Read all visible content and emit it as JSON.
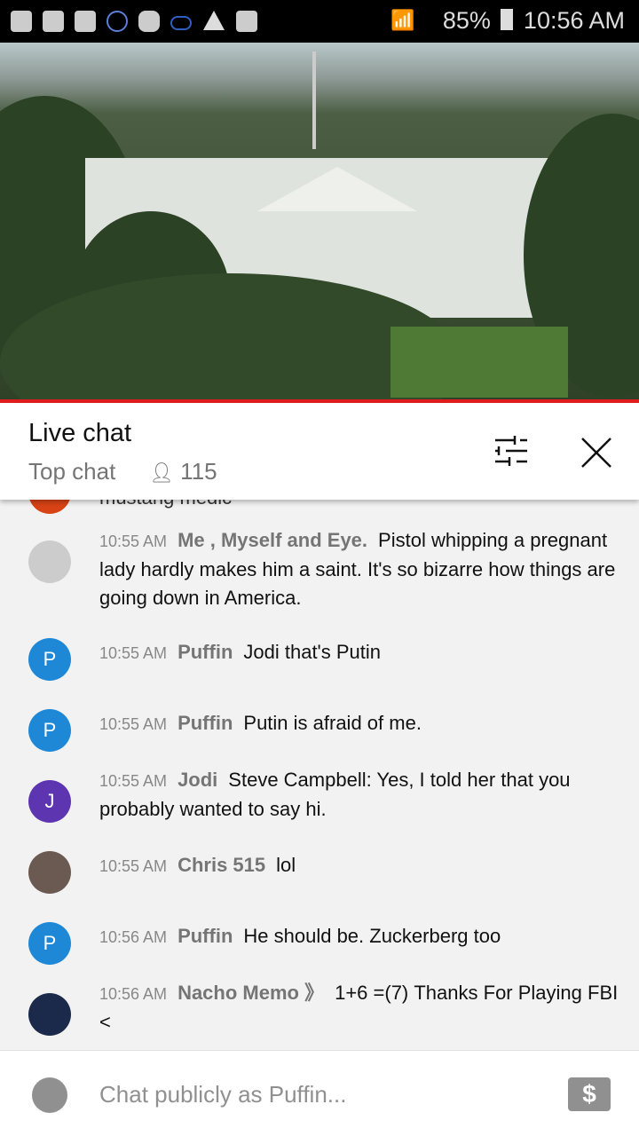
{
  "status_bar": {
    "battery": "85%",
    "time": "10:56 AM",
    "icons": [
      "folder-icon",
      "youtube-icon",
      "youtube-icon",
      "pokeball-icon",
      "m-app-icon",
      "cloud-icon",
      "warning-icon",
      "image-icon",
      "wifi-icon",
      "signal-icon",
      "battery-icon"
    ]
  },
  "header": {
    "title": "Live chat",
    "mode": "Top chat",
    "viewers": "115"
  },
  "colors": {
    "accent": "#e21c1c"
  },
  "partial_message": {
    "author": "mustang medic"
  },
  "messages": [
    {
      "time": "10:55 AM",
      "author": "Me , Myself and Eye.",
      "text": "Pistol whipping a pregnant lady hardly makes him a saint. It's so bizarre how things are going down in America.",
      "avatar": "",
      "avatar_color": "#ccc"
    },
    {
      "time": "10:55 AM",
      "author": "Puffin",
      "text": "Jodi that's Putin",
      "avatar": "P",
      "avatar_color": "#1e88d6"
    },
    {
      "time": "10:55 AM",
      "author": "Puffin",
      "text": "Putin is afraid of me.",
      "avatar": "P",
      "avatar_color": "#1e88d6"
    },
    {
      "time": "10:55 AM",
      "author": "Jodi",
      "text": "Steve Campbell: Yes, I told her that you probably wanted to say hi.",
      "avatar": "J",
      "avatar_color": "#5e35b1"
    },
    {
      "time": "10:55 AM",
      "author": "Chris 515",
      "text": "lol",
      "avatar": "",
      "avatar_color": "#6b5a52"
    },
    {
      "time": "10:56 AM",
      "author": "Puffin",
      "text": "He should be. Zuckerberg too",
      "avatar": "P",
      "avatar_color": "#1e88d6"
    },
    {
      "time": "10:56 AM",
      "author": "Nacho Memo 》",
      "text": "1+6 =(7) Thanks For Playing FBI <",
      "avatar": "",
      "avatar_color": "#1b2a4a"
    }
  ],
  "input": {
    "placeholder": "Chat publicly as Puffin..."
  }
}
